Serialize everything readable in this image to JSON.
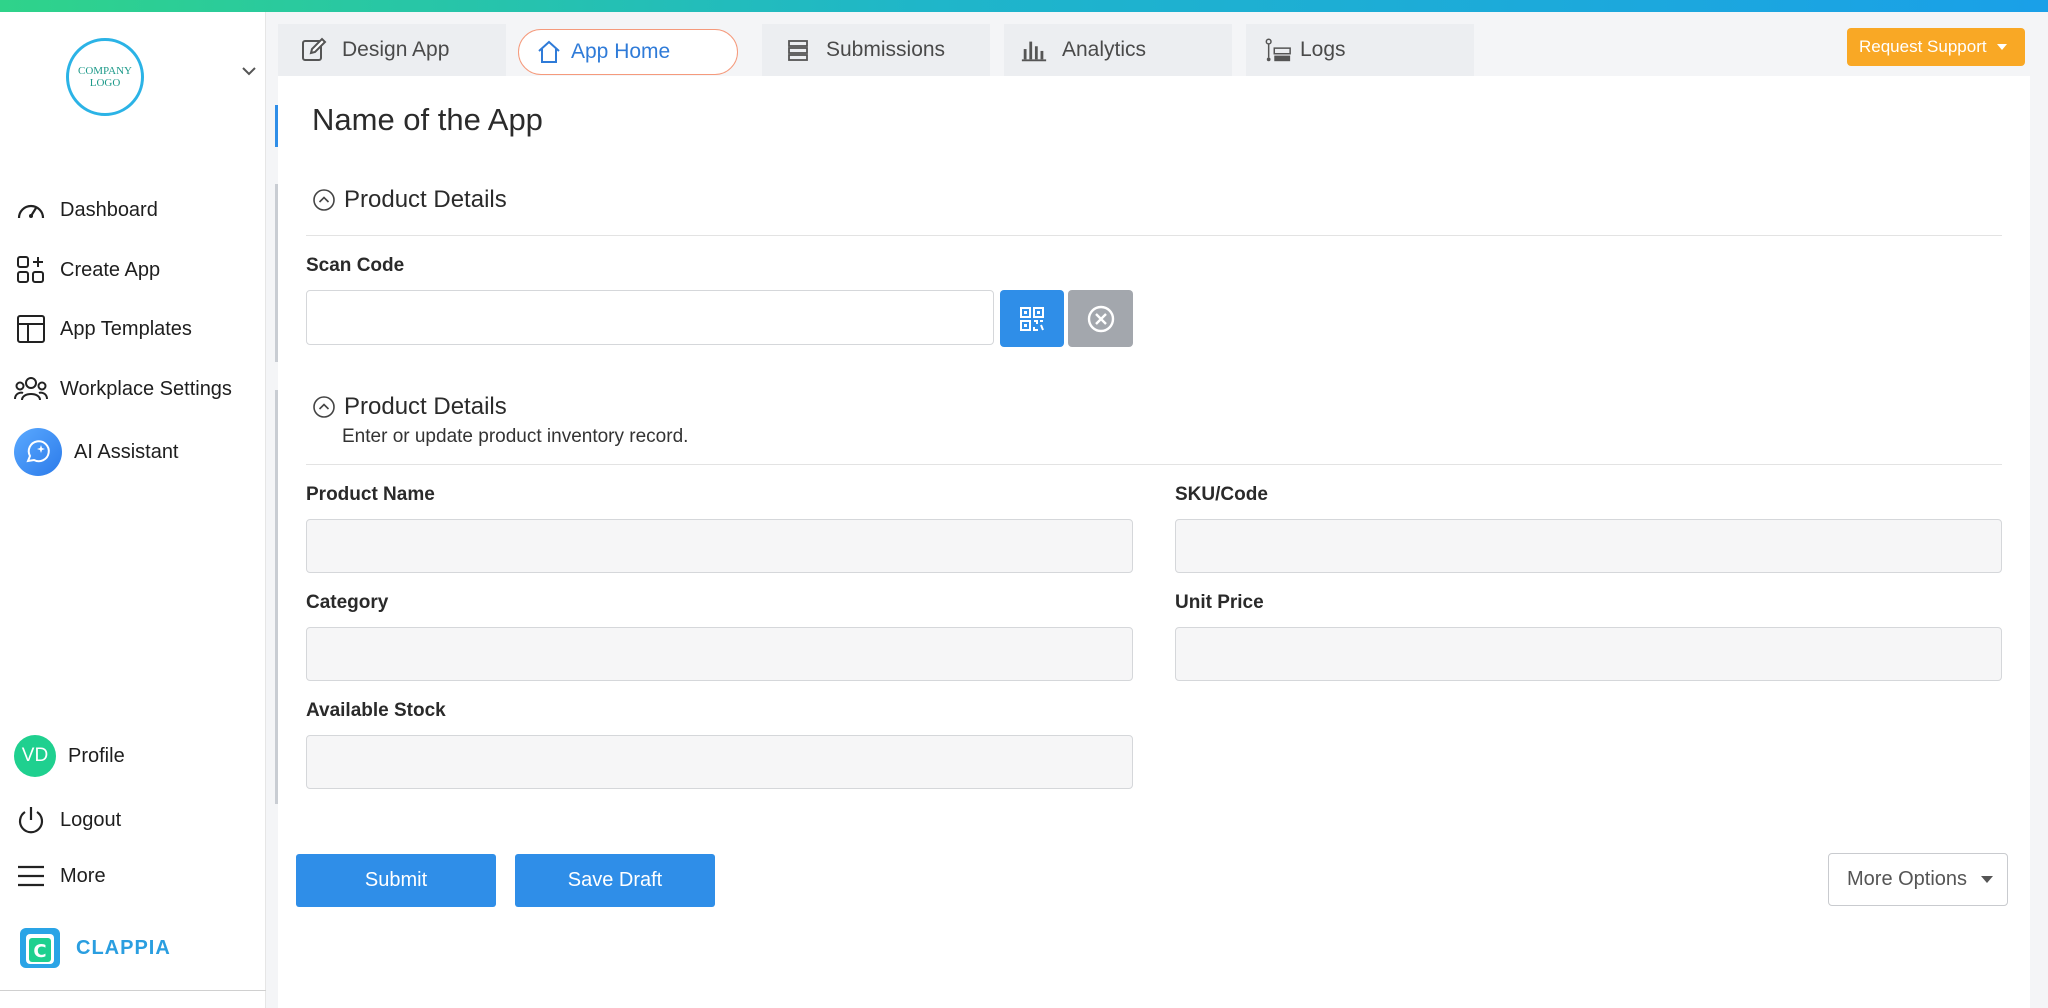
{
  "sidebar": {
    "logo_text": "COMPANY LOGO",
    "items": [
      {
        "label": "Dashboard",
        "icon": "gauge-icon"
      },
      {
        "label": "Create App",
        "icon": "grid-plus-icon"
      },
      {
        "label": "App Templates",
        "icon": "template-icon"
      },
      {
        "label": "Workplace Settings",
        "icon": "users-icon"
      },
      {
        "label": "AI Assistant",
        "icon": "ai-sparkle-icon"
      }
    ],
    "bottom_items": [
      {
        "label": "Profile",
        "avatar": "VD"
      },
      {
        "label": "Logout",
        "icon": "power-icon"
      },
      {
        "label": "More",
        "icon": "menu-icon"
      }
    ],
    "brand": "CLAPPIA"
  },
  "tabs": [
    {
      "label": "Design App",
      "icon": "edit-icon"
    },
    {
      "label": "App Home",
      "icon": "home-icon",
      "active": true
    },
    {
      "label": "Submissions",
      "icon": "stack-icon"
    },
    {
      "label": "Analytics",
      "icon": "bar-chart-icon"
    },
    {
      "label": "Logs",
      "icon": "logs-icon"
    }
  ],
  "header": {
    "support_label": "Request Support"
  },
  "app": {
    "title": "Name of the App",
    "section1": {
      "title": "Product Details",
      "scan_label": "Scan Code",
      "scan_value": ""
    },
    "section2": {
      "title": "Product Details",
      "description": "Enter or update product inventory record.",
      "fields": {
        "product_name": {
          "label": "Product Name",
          "value": ""
        },
        "sku": {
          "label": "SKU/Code",
          "value": ""
        },
        "category": {
          "label": "Category",
          "value": ""
        },
        "unit_price": {
          "label": "Unit Price",
          "value": ""
        },
        "available_stock": {
          "label": "Available Stock",
          "value": ""
        }
      }
    }
  },
  "actions": {
    "submit": "Submit",
    "save_draft": "Save Draft",
    "more_options": "More Options"
  },
  "colors": {
    "primary": "#2f8ee8",
    "support": "#f9a825",
    "avatar": "#1fd08f",
    "brand": "#2a9ee0"
  }
}
